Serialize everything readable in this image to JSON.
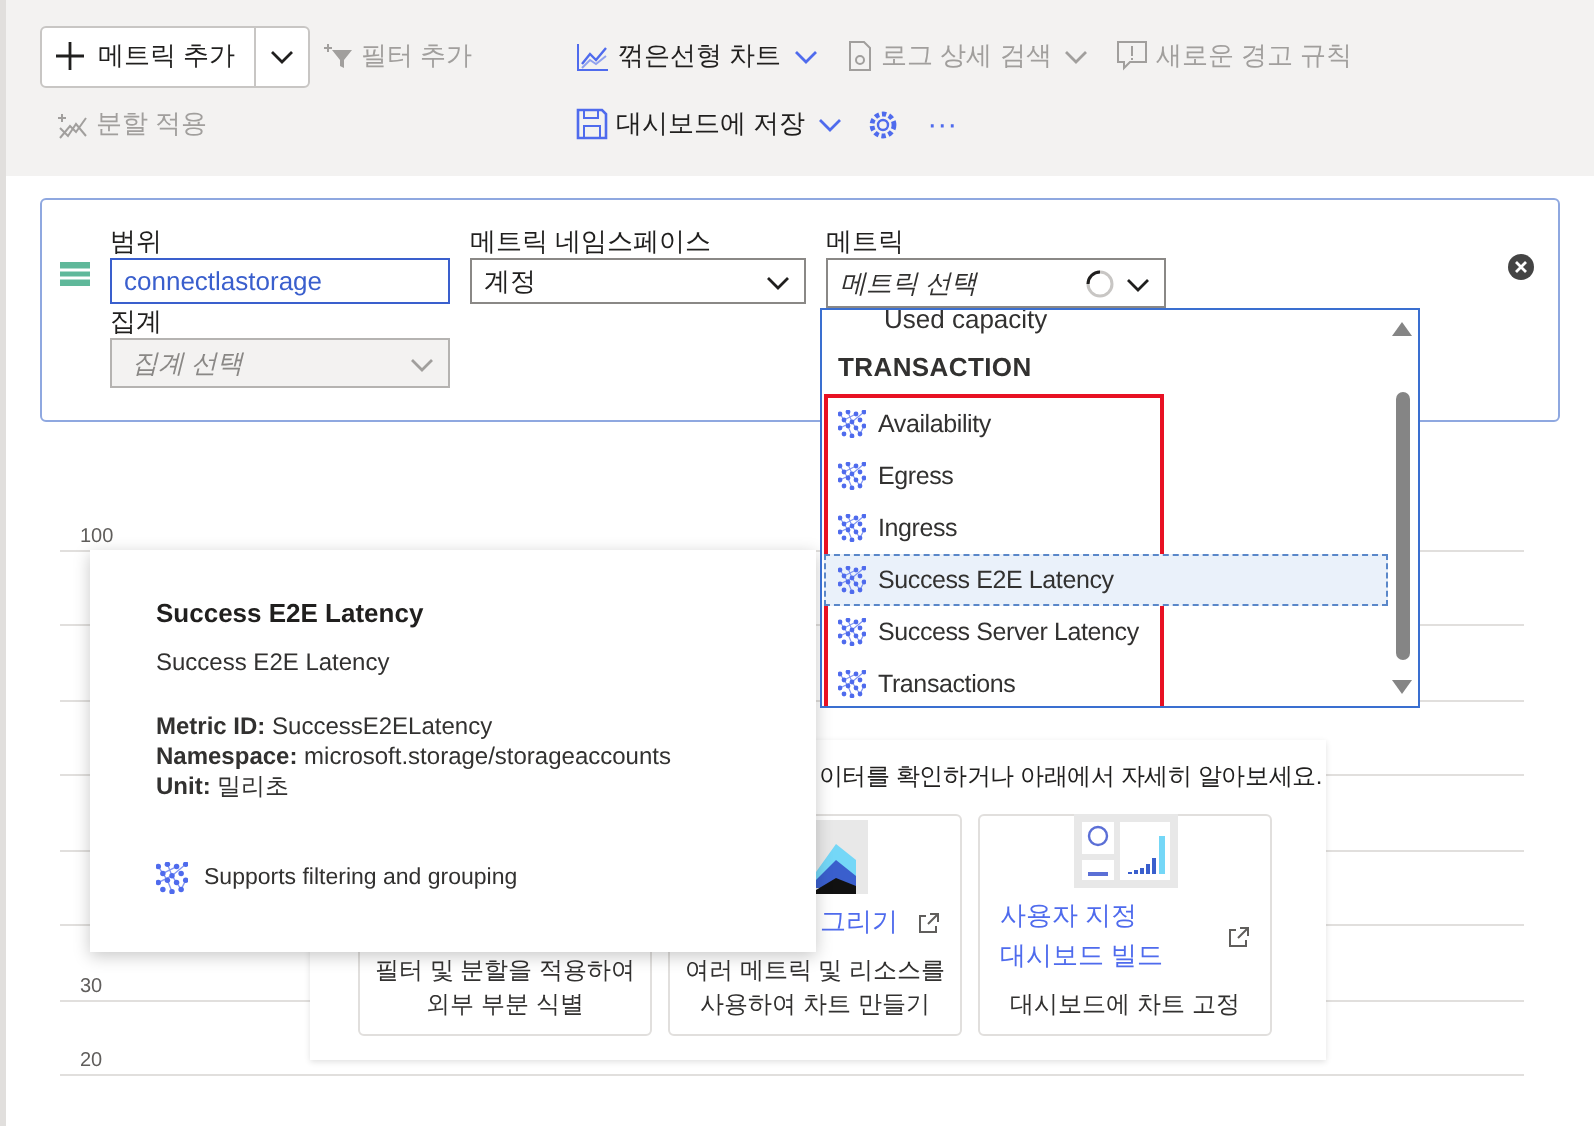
{
  "toolbar": {
    "add_metric": {
      "label": "메트릭 추가"
    },
    "add_filter": {
      "label": "필터 추가",
      "disabled": true
    },
    "chart_type": {
      "label": "꺾은선형 차트"
    },
    "logs": {
      "label": "로그 상세 검색",
      "disabled": true
    },
    "alert": {
      "label": "새로운 경고 규칙",
      "disabled": true
    },
    "apply_splitting": {
      "label": "분할 적용",
      "disabled": true
    },
    "save_dashboard": {
      "label": "대시보드에 저장"
    },
    "more": {
      "label": "···"
    }
  },
  "editor": {
    "scope": {
      "label": "범위",
      "value": "connectlastorage"
    },
    "aggregation": {
      "label": "집계",
      "placeholder": "집계 선택",
      "disabled": true
    },
    "namespace": {
      "label": "메트릭 네임스페이스",
      "value": "계정"
    },
    "metric": {
      "label": "메트릭",
      "placeholder": "메트릭 선택",
      "loading": true
    }
  },
  "dropdown": {
    "above": "Used capacity",
    "group": {
      "header": "TRANSACTION",
      "highlighted": true,
      "metrics": [
        {
          "label": "Availability",
          "selected": false
        },
        {
          "label": "Egress",
          "selected": false
        },
        {
          "label": "Ingress",
          "selected": false
        },
        {
          "label": "Success E2E Latency",
          "selected": true
        },
        {
          "label": "Success Server Latency",
          "selected": false
        },
        {
          "label": "Transactions",
          "selected": false
        }
      ]
    }
  },
  "tooltip": {
    "title": "Success E2E Latency",
    "subtitle": "Success E2E Latency",
    "details": [
      "**Metric ID:** SuccessE2ELatency",
      "**Namespace:** microsoft.storage/storageaccounts",
      "**Unit:** 밀리초"
    ],
    "feature": "Supports filtering and grouping"
  },
  "chart": {
    "y_labels": [
      "100",
      "30",
      "20"
    ]
  },
  "empty_state": {
    "message": "이터를 확인하거나 아래에서 자세히 알아보세요.",
    "tiles": [
      {
        "kind": "covered",
        "description": "필터 및 분할을 적용하여 외부 부분 식별"
      },
      {
        "kind": "link",
        "link": "그리기",
        "description": "여러 메트릭 및 리소스를 사용하여 차트 만들기"
      },
      {
        "kind": "link",
        "link": "사용자 지정 대시보드 빌드",
        "description": "대시보드에 차트 고정"
      }
    ]
  }
}
